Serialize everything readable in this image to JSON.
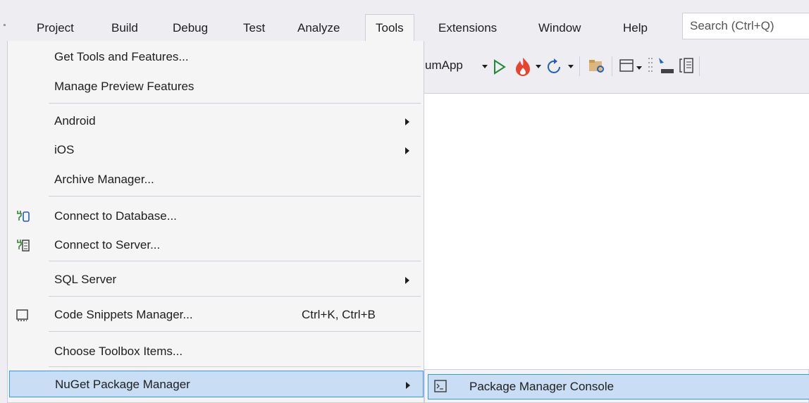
{
  "menubar": {
    "items": [
      "Project",
      "Build",
      "Debug",
      "Test",
      "Analyze",
      "Tools",
      "Extensions",
      "Window",
      "Help"
    ],
    "open_item": "Tools",
    "search_placeholder": "Search (Ctrl+Q)"
  },
  "toolbar": {
    "target_label": "umApp"
  },
  "tools_menu": {
    "items": [
      {
        "label": "Get Tools and Features..."
      },
      {
        "label": "Manage Preview Features"
      },
      {
        "label": "Android",
        "submenu": true
      },
      {
        "label": "iOS",
        "submenu": true
      },
      {
        "label": "Archive Manager..."
      },
      {
        "label": "Connect to Database...",
        "icon": "database-plug-icon"
      },
      {
        "label": "Connect to Server...",
        "icon": "server-plug-icon"
      },
      {
        "label": "SQL Server",
        "submenu": true
      },
      {
        "label": "Code Snippets Manager...",
        "shortcut": "Ctrl+K, Ctrl+B",
        "icon": "code-snippet-icon"
      },
      {
        "label": "Choose Toolbox Items..."
      },
      {
        "label": "NuGet Package Manager",
        "submenu": true,
        "highlighted": true
      }
    ]
  },
  "nuget_submenu": {
    "items": [
      {
        "label": "Package Manager Console",
        "icon": "console-icon",
        "highlighted": true
      }
    ]
  },
  "colors": {
    "menu_background": "#f5f5f5",
    "highlight_background": "#c9def5",
    "highlight_border": "#3399ff",
    "run_green": "#1e8b3a",
    "hot_reload_red": "#e8432e"
  }
}
